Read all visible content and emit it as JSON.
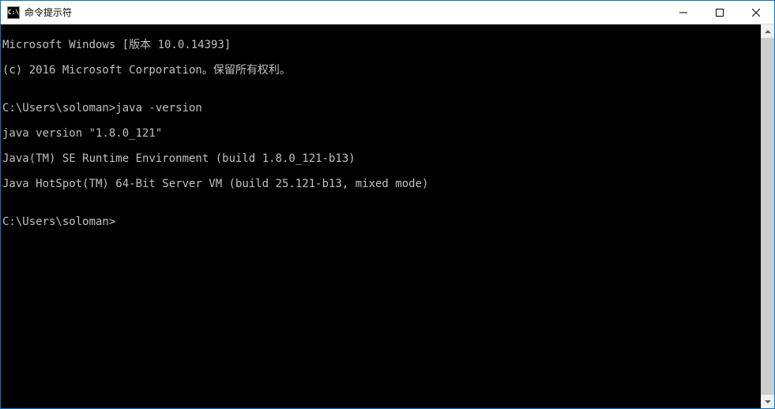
{
  "titlebar": {
    "icon_text": "C:\\",
    "title": "命令提示符"
  },
  "terminal": {
    "lines": [
      "Microsoft Windows [版本 10.0.14393]",
      "(c) 2016 Microsoft Corporation。保留所有权利。",
      "",
      "C:\\Users\\soloman>java -version",
      "java version \"1.8.0_121\"",
      "Java(TM) SE Runtime Environment (build 1.8.0_121-b13)",
      "Java HotSpot(TM) 64-Bit Server VM (build 25.121-b13, mixed mode)",
      "",
      "C:\\Users\\soloman>"
    ]
  }
}
